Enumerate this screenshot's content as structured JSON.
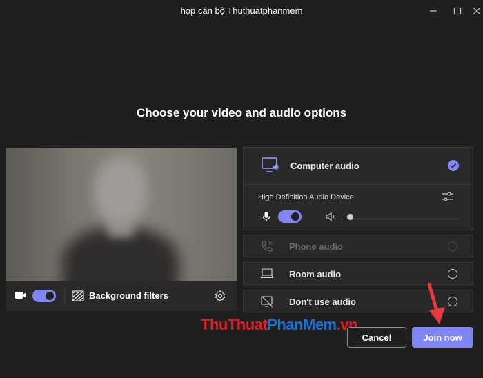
{
  "window": {
    "title": "họp cán bộ Thuthuatphanmem",
    "minimize_label": "–",
    "maximize_label": "□",
    "close_label": "✕"
  },
  "heading": "Choose your video and audio options",
  "video": {
    "camera_on": true,
    "background_filters_label": "Background filters"
  },
  "audio": {
    "computer_audio_label": "Computer audio",
    "computer_audio_selected": true,
    "device_label": "High Definition Audio Device",
    "mic_on": true,
    "speaker_volume": 0.05,
    "options": [
      {
        "label": "Phone audio",
        "icon": "phone-icon",
        "enabled": false,
        "selected": false
      },
      {
        "label": "Room audio",
        "icon": "room-display-icon",
        "enabled": true,
        "selected": false
      },
      {
        "label": "Don't use audio",
        "icon": "no-audio-icon",
        "enabled": true,
        "selected": false
      }
    ]
  },
  "watermark": {
    "part_a": "ThuThuat",
    "part_b": "PhanMem",
    "part_c": ".vn"
  },
  "buttons": {
    "cancel": "Cancel",
    "join": "Join now"
  },
  "colors": {
    "accent": "#7f85f5",
    "background": "#1f1f1f",
    "panel": "#292929",
    "annotation_arrow": "#e8393f"
  }
}
